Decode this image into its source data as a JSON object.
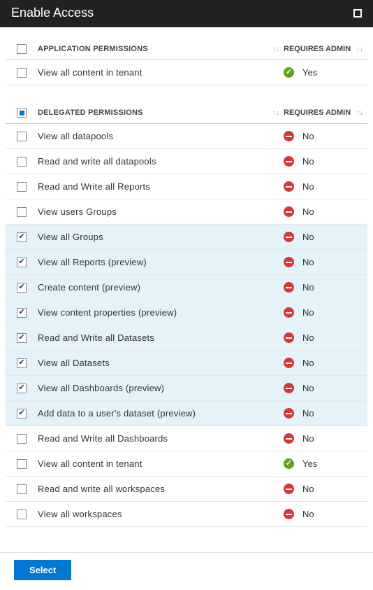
{
  "title": "Enable Access",
  "columns": {
    "app_permissions": "APPLICATION PERMISSIONS",
    "del_permissions": "DELEGATED PERMISSIONS",
    "requires_admin": "REQUIRES ADMIN",
    "sort_glyph": "↑↓"
  },
  "application_permissions_checked": "none",
  "application_permissions": [
    {
      "label": "View all content in tenant",
      "admin": "Yes",
      "checked": false
    }
  ],
  "delegated_permissions_checked": "indet",
  "delegated_permissions": [
    {
      "label": "View all datapools",
      "admin": "No",
      "checked": false
    },
    {
      "label": "Read and write all datapools",
      "admin": "No",
      "checked": false
    },
    {
      "label": "Read and Write all Reports",
      "admin": "No",
      "checked": false
    },
    {
      "label": "View users Groups",
      "admin": "No",
      "checked": false
    },
    {
      "label": "View all Groups",
      "admin": "No",
      "checked": true
    },
    {
      "label": "View all Reports (preview)",
      "admin": "No",
      "checked": true
    },
    {
      "label": "Create content (preview)",
      "admin": "No",
      "checked": true
    },
    {
      "label": "View content properties (preview)",
      "admin": "No",
      "checked": true
    },
    {
      "label": "Read and Write all Datasets",
      "admin": "No",
      "checked": true
    },
    {
      "label": "View all Datasets",
      "admin": "No",
      "checked": true
    },
    {
      "label": "View all Dashboards (preview)",
      "admin": "No",
      "checked": true
    },
    {
      "label": "Add data to a user's dataset (preview)",
      "admin": "No",
      "checked": true
    },
    {
      "label": "Read and Write all Dashboards",
      "admin": "No",
      "checked": false
    },
    {
      "label": "View all content in tenant",
      "admin": "Yes",
      "checked": false
    },
    {
      "label": "Read and write all workspaces",
      "admin": "No",
      "checked": false
    },
    {
      "label": "View all workspaces",
      "admin": "No",
      "checked": false
    }
  ],
  "footer": {
    "select_label": "Select"
  }
}
